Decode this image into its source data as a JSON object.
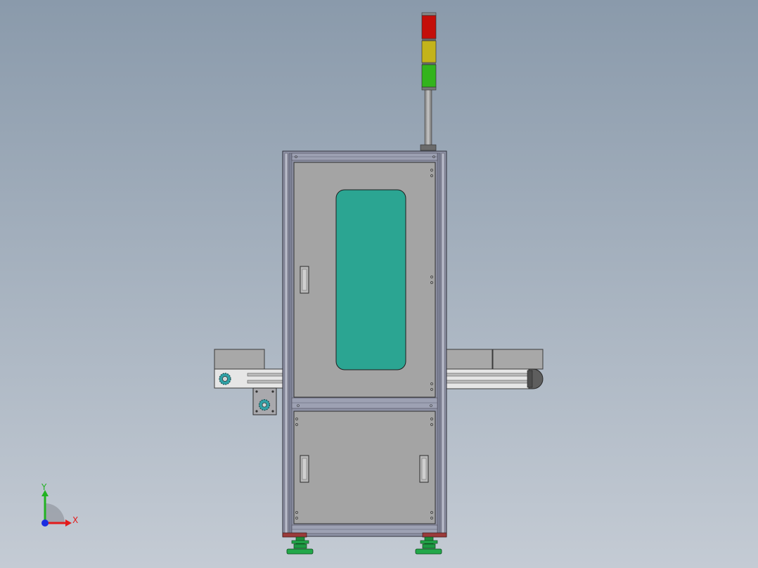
{
  "viewport": {
    "background_top": "#8a9aab",
    "background_bottom": "#c4cbd4"
  },
  "model": {
    "frame_color": "#8f93a6",
    "panel_color": "#a4a4a4",
    "window_color": "#2ba592",
    "foot_color": "#22a84a",
    "motor_color": "#2fa1a6"
  },
  "signal_tower": {
    "lights": [
      {
        "name": "red",
        "color": "#c40e0a"
      },
      {
        "name": "yellow",
        "color": "#c3b31a"
      },
      {
        "name": "green",
        "color": "#33b41c"
      }
    ]
  },
  "triad": {
    "x_label": "X",
    "y_label": "Y",
    "x_color": "#e31b1b",
    "y_color": "#21b221",
    "z_color": "#1b2ce0"
  }
}
